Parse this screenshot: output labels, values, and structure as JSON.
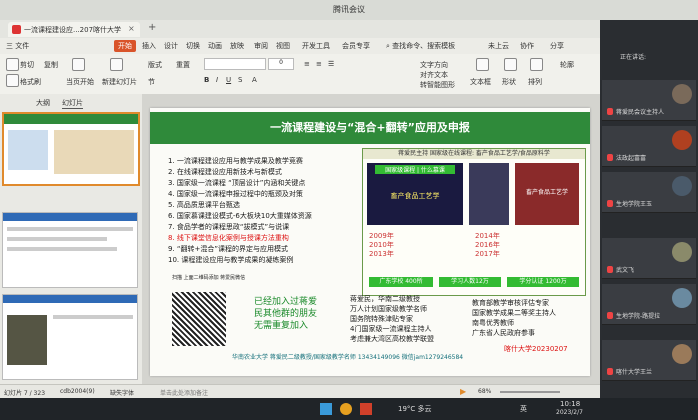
{
  "meeting": {
    "title": "腾讯会议",
    "speaking_label": "正在讲话:"
  },
  "wps": {
    "doc_tab": "一流课程建设应...207喀什大学",
    "menus": [
      "三 文件",
      "开始",
      "插入",
      "设计",
      "切换",
      "动画",
      "放映",
      "审阅",
      "视图",
      "开发工具",
      "会员专享"
    ],
    "active_menu": "开始",
    "search_label": "查找命令、搜索模板",
    "right_menus": [
      "未上云",
      "协作",
      "分享"
    ],
    "ribbon": {
      "paste": "剪切",
      "copy": "复制",
      "format": "格式刷",
      "from_start": "当页开始",
      "new_slide": "新建幻灯片",
      "layout": "版式",
      "section": "节",
      "reset": "重置",
      "font": "",
      "size": "0",
      "textbox": "文本框",
      "shape": "形状",
      "arrange": "排列",
      "outline": "轮廓",
      "textdir": "文字方向",
      "align": "对齐文本",
      "smart": "转智能图形"
    },
    "panel_tabs": [
      "大纲",
      "幻灯片"
    ]
  },
  "slide": {
    "title": "一流课程建设与“混合+翻转”应用及申报",
    "items": [
      "1. 一流课程建设应用与教学成果及教学竞赛",
      "2. 在线课程建设应用新技术与新模式",
      "3. 国家级一流课程  “顶层设计”内涵和关键点",
      "4. 国家级一流课程申报过程中的瓶颈及对策",
      "5. 高品质思课平台甄选",
      "6. 国家慕课建设模式-6大板块10大重媒体资源",
      "7. 食品学者的课程思政“拔模式”与说课",
      "8. 线下课堂信息化案例与授课方法重构",
      "9. “翻转+混合”课程的界定与应用模式",
      "10. 课程建设应用与教学成果的凝练案例"
    ],
    "right_header": "蒋爱民主持 国家级在线课程: 畜产食品工艺学/食品原料学",
    "video_label": "国家级课程 | 什么慕课",
    "course_title": "畜产食品工艺学",
    "book_caption": "畜产食品工艺学",
    "timeline": [
      "2009年",
      "2010年",
      "2013年",
      "2014年",
      "2016年",
      "2017年"
    ],
    "counts": {
      "left": "广东学校 400所",
      "mid": "学习人数12万",
      "right": "学分认证 1200万"
    },
    "qr_caption": "扫描 上面二维码添加 蒋爱民微信",
    "join_text": [
      "已经加入过蒋爱",
      "民其他群的朋友",
      "无需重复加入"
    ],
    "bullets_left": [
      "蒋爱民，华南二级教授",
      "万人计划国家级教学名师",
      "国务院特殊津贴专家",
      "4门国家级一流课程主持人",
      "考虑兼大湾区高校教学联盟"
    ],
    "bullets_right": [
      "教育部教学审核评估专家",
      "国家教学成果二等奖主持人",
      "南粤优秀教师",
      "广东省人民政府参事"
    ],
    "footer": "华南农业大学  蒋爱民二级教授/国家级教学名师  13434149096  微信jam1279246584",
    "footer_tag": "喀什大学20230207"
  },
  "statusbar": {
    "page": "幻灯片 7 / 323",
    "theme": "cdb2004(9)",
    "font_missing": "缺失字体",
    "note_hint": "单击此处添加备注",
    "zoom": "68%"
  },
  "taskbar": {
    "weather": "19°C 多云",
    "time": "10:18",
    "date": "2023/2/7",
    "lang": "英"
  },
  "participants": [
    "蒋爱民会议主持人",
    "法政起富富",
    "生地学院王玉",
    "武文飞",
    "生地学院-路提拉",
    "喀什大学王兰"
  ]
}
